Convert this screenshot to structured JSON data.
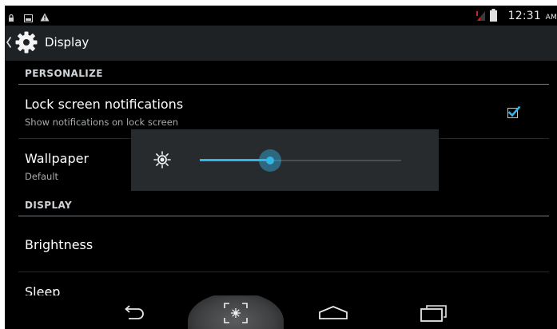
{
  "status_bar": {
    "time": "12:31",
    "ampm": "AM",
    "icons": [
      "lock-icon",
      "image-icon",
      "warning-icon",
      "signal-icon",
      "battery-icon"
    ]
  },
  "action_bar": {
    "title": "Display",
    "icons": [
      "chevron-left-icon",
      "gear-icon"
    ]
  },
  "sections": {
    "personalize": {
      "header": "PERSONALIZE",
      "lock_screen": {
        "title": "Lock screen notifications",
        "summary": "Show notifications on lock screen",
        "checked": true
      },
      "wallpaper": {
        "title": "Wallpaper",
        "summary": "Default"
      }
    },
    "display": {
      "header": "DISPLAY",
      "brightness": {
        "title": "Brightness"
      },
      "sleep": {
        "title": "Sleep"
      }
    }
  },
  "brightness_dialog": {
    "icon": "sun-icon",
    "level": 0.35
  },
  "nav_bar": {
    "buttons": [
      "back-icon",
      "screenshot-icon",
      "home-icon",
      "recent-apps-icon"
    ]
  },
  "colors": {
    "accent": "#33b5e5",
    "background": "#000000",
    "action_bar": "#1e2224",
    "panel": "#272b2e"
  }
}
